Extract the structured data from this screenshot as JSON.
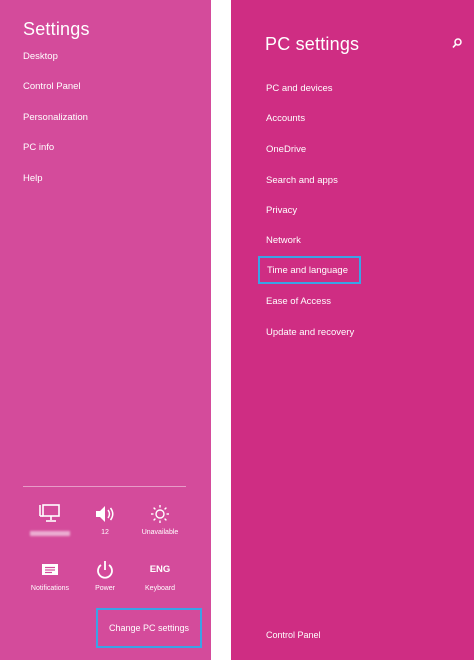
{
  "settings_pane": {
    "title": "Settings",
    "items": [
      {
        "label": "Desktop"
      },
      {
        "label": "Control Panel"
      },
      {
        "label": "Personalization"
      },
      {
        "label": "PC info"
      },
      {
        "label": "Help"
      }
    ],
    "quick_tiles": [
      {
        "icon": "network-icon",
        "label": ""
      },
      {
        "icon": "volume-icon",
        "label": "12"
      },
      {
        "icon": "brightness-icon",
        "label": "Unavailable"
      },
      {
        "icon": "notifications-icon",
        "label": "Notifications"
      },
      {
        "icon": "power-icon",
        "label": "Power"
      },
      {
        "icon": "keyboard-icon",
        "label": "Keyboard",
        "glyph": "ENG"
      }
    ],
    "change_pc_settings": "Change PC settings"
  },
  "pc_settings": {
    "title": "PC settings",
    "search_icon": "search-icon",
    "items": [
      {
        "label": "PC and devices"
      },
      {
        "label": "Accounts"
      },
      {
        "label": "OneDrive"
      },
      {
        "label": "Search and apps"
      },
      {
        "label": "Privacy"
      },
      {
        "label": "Network"
      },
      {
        "label": "Time and language",
        "highlighted": true
      },
      {
        "label": "Ease of Access"
      },
      {
        "label": "Update and recovery"
      }
    ],
    "footer_link": "Control Panel"
  },
  "colors": {
    "settings_bg": "#d44b9b",
    "pc_settings_bg": "#cf2d83",
    "highlight": "#3ba3e6"
  }
}
